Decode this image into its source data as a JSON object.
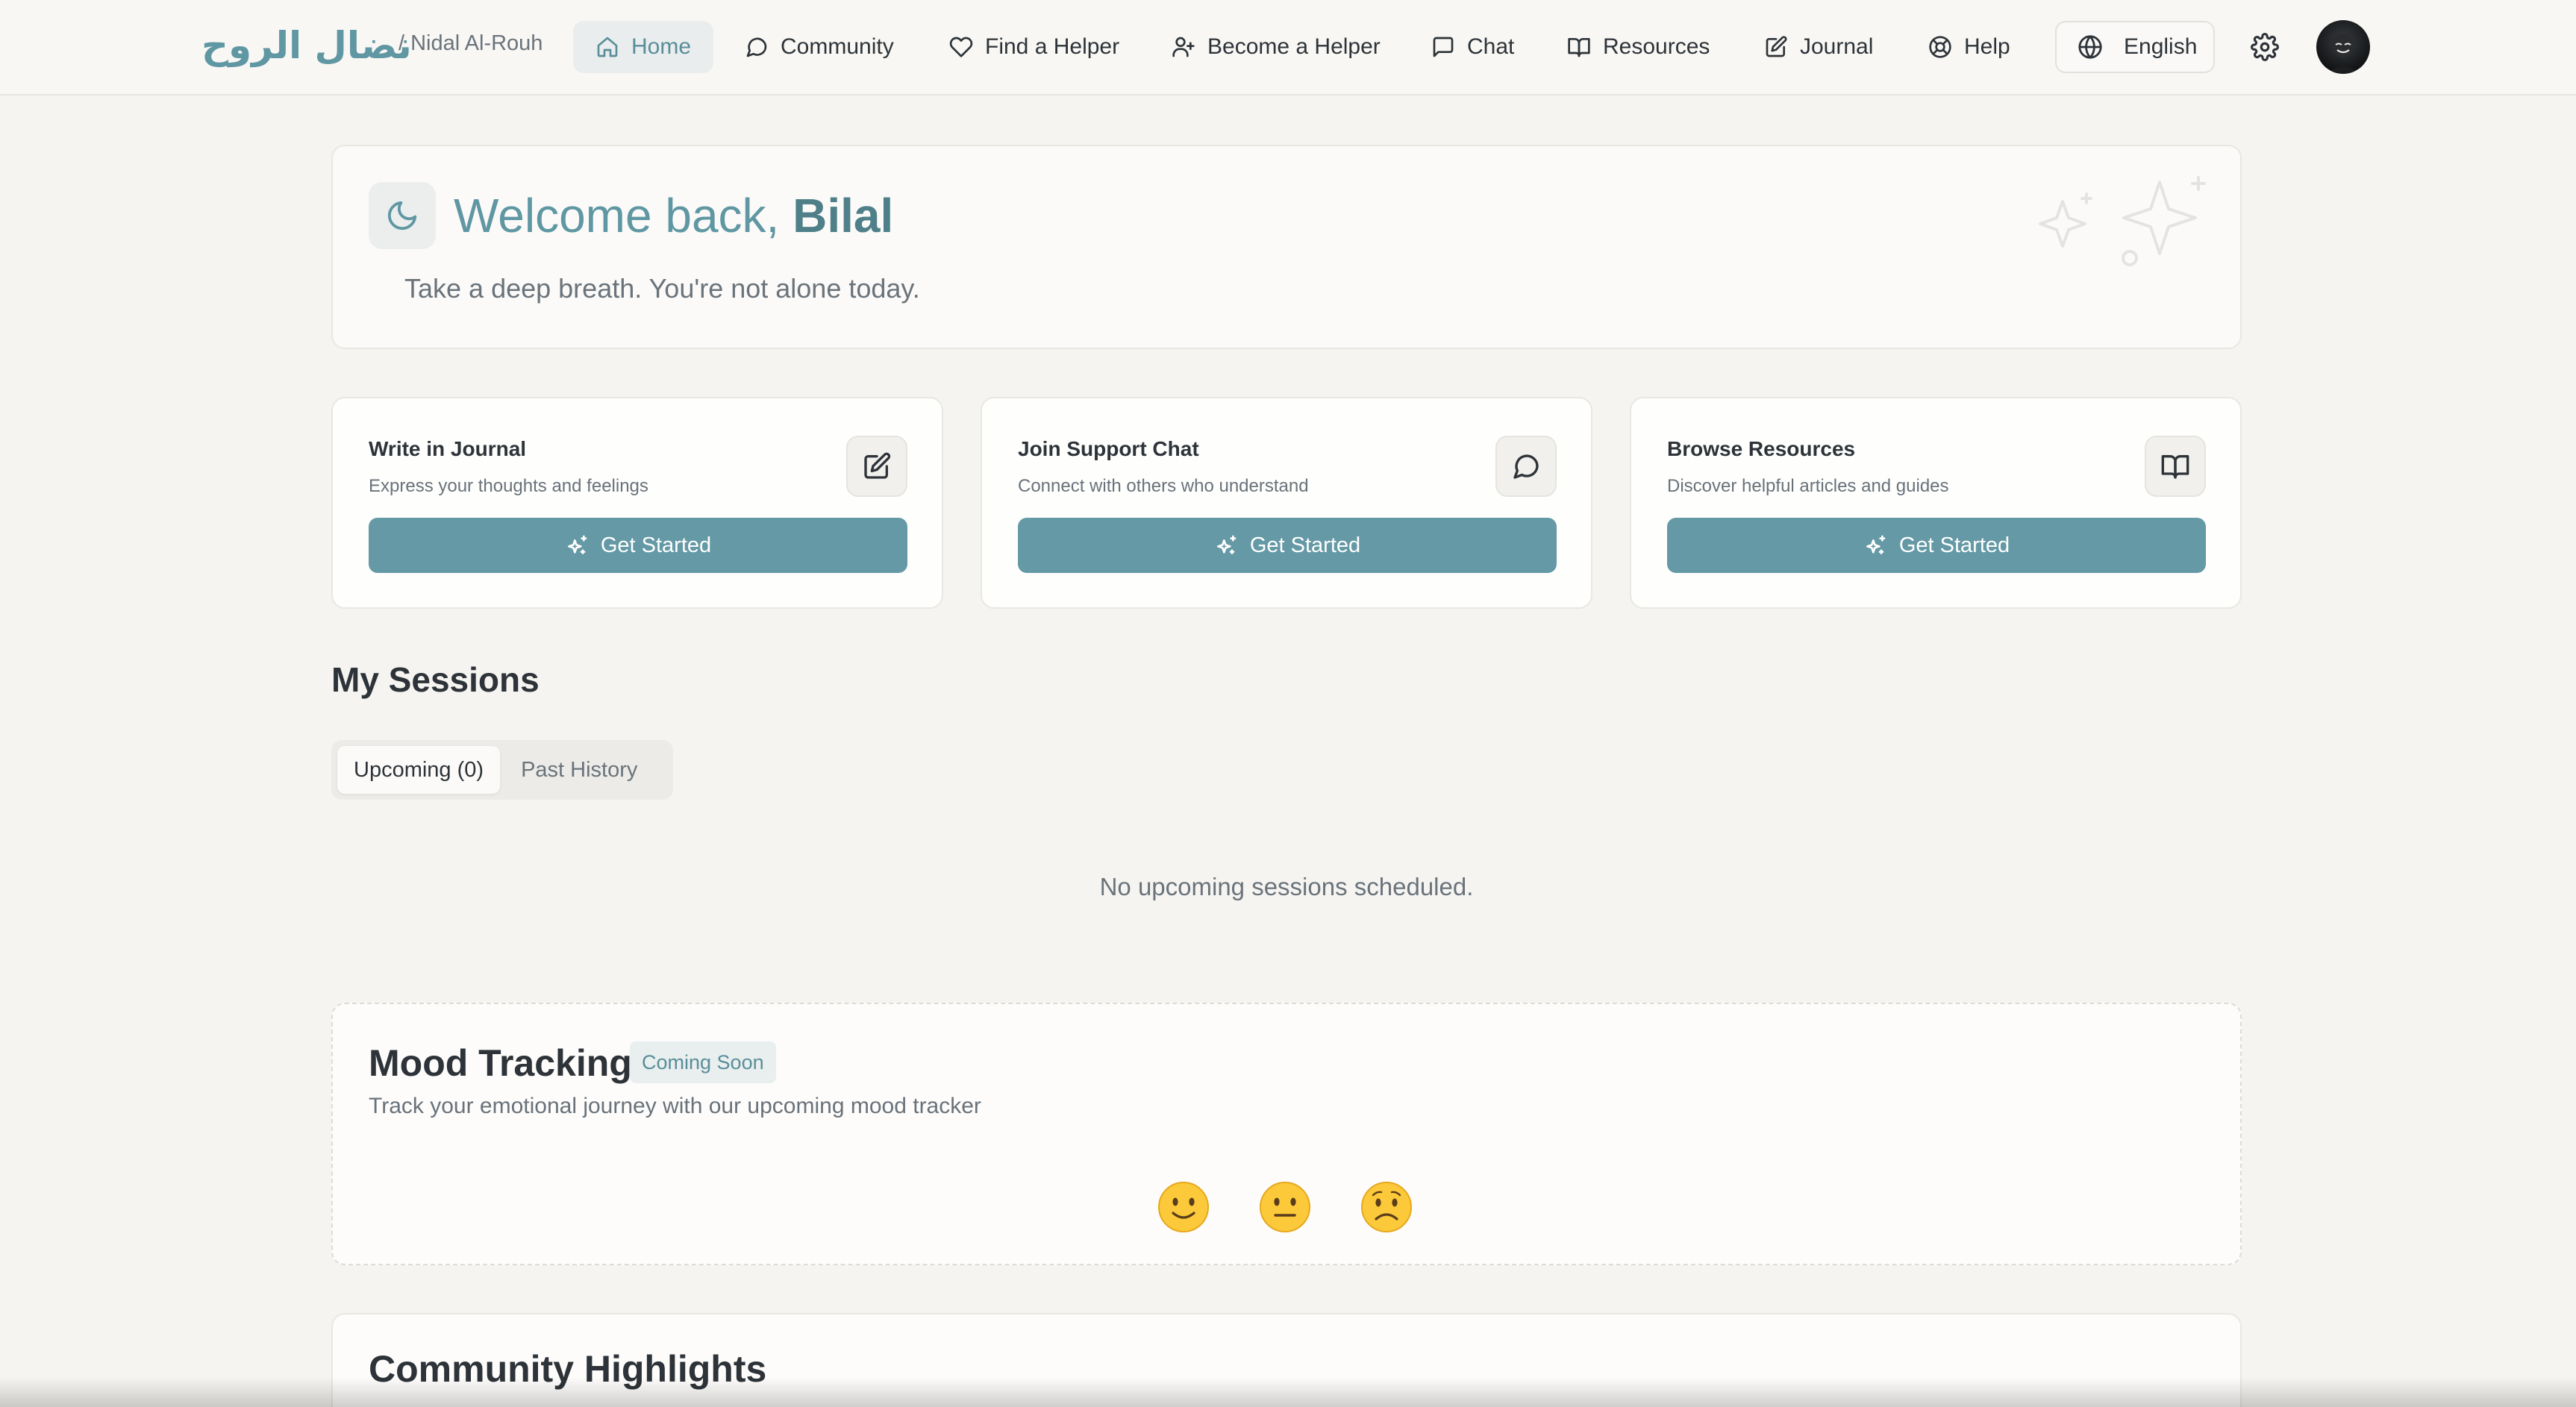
{
  "brand": {
    "logo_text": "نضال الروح",
    "sub_label": "/ Nidal Al-Rouh"
  },
  "nav": {
    "items": [
      {
        "label": "Home",
        "icon": "home-icon"
      },
      {
        "label": "Community",
        "icon": "message-circle-icon"
      },
      {
        "label": "Find a Helper",
        "icon": "heart-icon"
      },
      {
        "label": "Become a Helper",
        "icon": "user-plus-icon"
      },
      {
        "label": "Chat",
        "icon": "message-square-icon"
      },
      {
        "label": "Resources",
        "icon": "book-open-icon"
      },
      {
        "label": "Journal",
        "icon": "edit-icon"
      },
      {
        "label": "Help",
        "icon": "life-buoy-icon"
      }
    ],
    "active": "Home",
    "language": "English"
  },
  "welcome": {
    "greeting": "Welcome back,",
    "name": "Bilal",
    "subtitle": "Take a deep breath. You're not alone today."
  },
  "actions": [
    {
      "title": "Write in Journal",
      "description": "Express your thoughts and feelings",
      "button": "Get Started",
      "icon": "edit-icon"
    },
    {
      "title": "Join Support Chat",
      "description": "Connect with others who understand",
      "button": "Get Started",
      "icon": "message-circle-icon"
    },
    {
      "title": "Browse Resources",
      "description": "Discover helpful articles and guides",
      "button": "Get Started",
      "icon": "book-open-icon"
    }
  ],
  "sessions": {
    "title": "My Sessions",
    "tabs": [
      "Upcoming (0)",
      "Past History"
    ],
    "active_tab": "Upcoming (0)",
    "empty_message": "No upcoming sessions scheduled."
  },
  "mood": {
    "title": "Mood Tracking",
    "badge": "Coming Soon",
    "description": "Track your emotional journey with our upcoming mood tracker",
    "emojis": [
      "slightly-smiling-face",
      "neutral-face",
      "frowning-face"
    ]
  },
  "community": {
    "title": "Community Highlights"
  },
  "colors": {
    "accent": "#6499a5",
    "accent_text": "#5f97a3",
    "background": "#f5f4f1"
  }
}
